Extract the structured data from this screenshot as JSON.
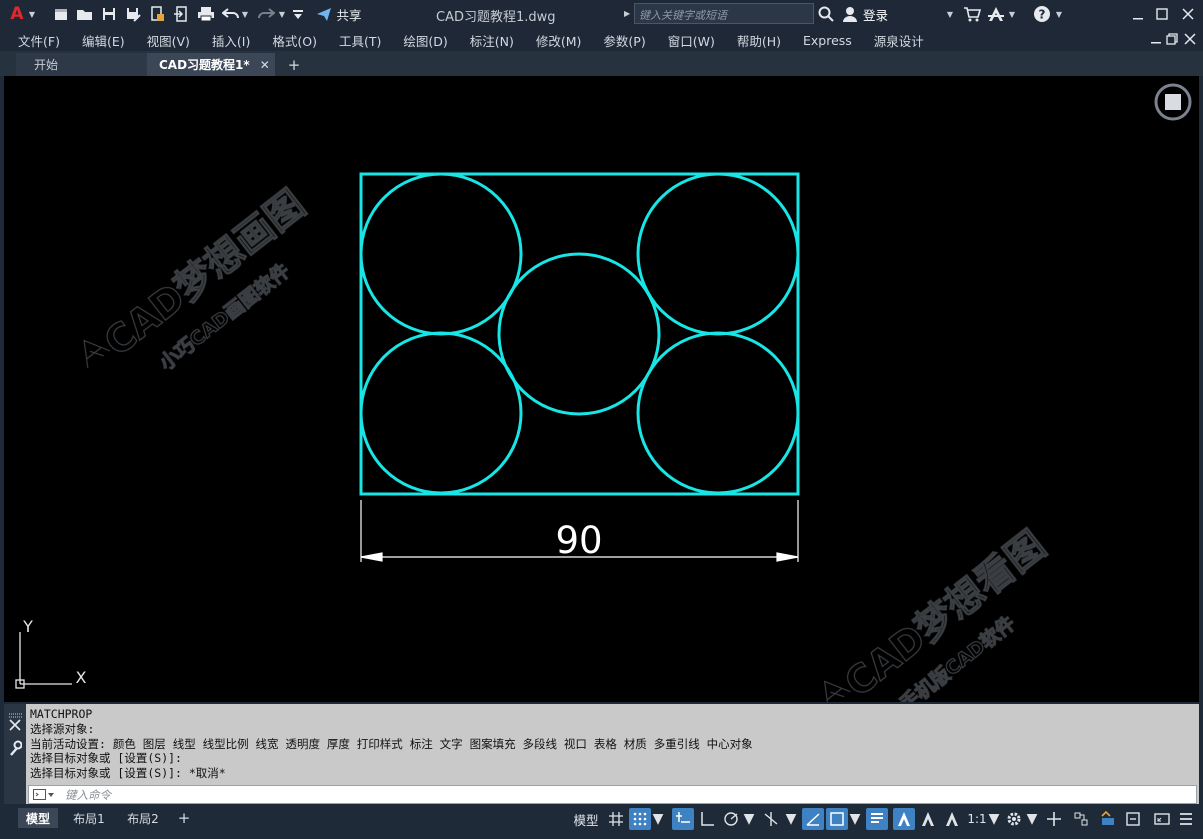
{
  "titlebar": {
    "app_icon": "A",
    "share_label": "共享",
    "document_title": "CAD习题教程1.dwg",
    "search_placeholder": "键入关键字或短语",
    "login_label": "登录"
  },
  "menubar": {
    "items": [
      "文件(F)",
      "编辑(E)",
      "视图(V)",
      "插入(I)",
      "格式(O)",
      "工具(T)",
      "绘图(D)",
      "标注(N)",
      "修改(M)",
      "参数(P)",
      "窗口(W)",
      "帮助(H)",
      "Express",
      "源泉设计"
    ]
  },
  "tabs": {
    "start": "开始",
    "document": "CAD习题教程1*",
    "close_glyph": "✕",
    "add_glyph": "+"
  },
  "drawing": {
    "dimension_text": "90",
    "axis_y": "Y",
    "axis_x": "X",
    "line_color": "#18e6e6",
    "watermark_main": "CAD梦想画图",
    "watermark_sub_top": "小巧CAD画图软件",
    "watermark_main_bottom": "CAD梦想看图",
    "watermark_sub_bottom": "手机版CAD软件"
  },
  "command": {
    "history": [
      "MATCHPROP",
      "选择源对象:",
      "当前活动设置:  颜色 图层 线型 线型比例 线宽 透明度 厚度 打印样式 标注 文字 图案填充 多段线 视口 表格 材质 多重引线 中心对象",
      "选择目标对象或 [设置(S)]:",
      "选择目标对象或 [设置(S)]: *取消*"
    ],
    "input_placeholder": "键入命令"
  },
  "layout_tabs": [
    "模型",
    "布局1",
    "布局2"
  ],
  "statusbar": {
    "model_label": "模型",
    "scale_label": "1:1"
  }
}
